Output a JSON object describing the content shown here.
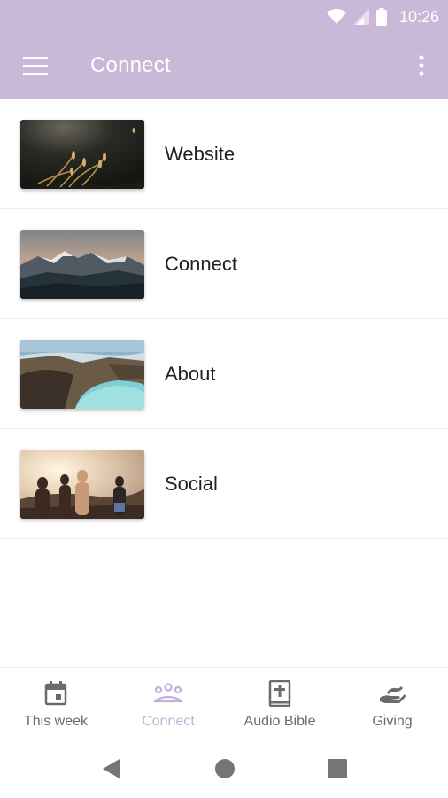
{
  "status_bar": {
    "time": "10:26",
    "icons": [
      "wifi-icon",
      "cellular-signal-icon",
      "battery-icon"
    ]
  },
  "app_bar": {
    "title": "Connect",
    "background_color": "#c9b8d8",
    "left_icon": "hamburger-menu-icon",
    "right_icon": "more-vertical-icon"
  },
  "list": {
    "items": [
      {
        "label": "Website",
        "image": "wheat-grass-at-dusk-photo"
      },
      {
        "label": "Connect",
        "image": "snowy-mountains-photo"
      },
      {
        "label": "About",
        "image": "crater-lake-photo"
      },
      {
        "label": "Social",
        "image": "group-of-friends-sunset-photo"
      }
    ]
  },
  "bottom_nav": {
    "active_color": "#c2b0d8",
    "items": [
      {
        "label": "This week",
        "icon": "calendar-icon",
        "active": false
      },
      {
        "label": "Connect",
        "icon": "people-group-icon",
        "active": true
      },
      {
        "label": "Audio Bible",
        "icon": "bible-book-icon",
        "active": false
      },
      {
        "label": "Giving",
        "icon": "giving-hand-icon",
        "active": false
      }
    ]
  },
  "system_nav": {
    "icons": [
      "back-triangle-icon",
      "home-circle-icon",
      "recents-square-icon"
    ]
  }
}
